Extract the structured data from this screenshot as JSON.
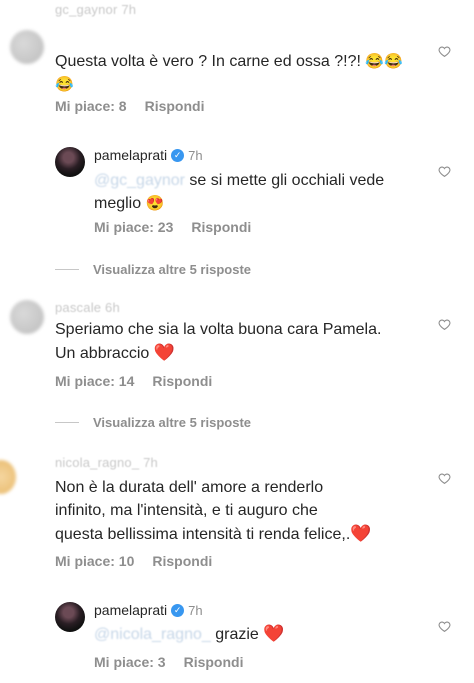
{
  "comments": [
    {
      "author": "gc_gaynor 7h",
      "text": "Questa volta è vero ? In carne ed ossa ?!?!",
      "emoji": "😂😂😂",
      "likes": "Mi piace: 8",
      "reply": "Rispondi"
    },
    {
      "author": "pamelaprati",
      "time": "7h",
      "mention": "@gc_gaynor",
      "text": "se si mette gli occhiali vede meglio",
      "emoji": "😍",
      "likes": "Mi piace: 23",
      "reply": "Rispondi"
    },
    {
      "author": "pascale 6h",
      "text_line1": "Speriamo che sia la volta buona cara Pamela.",
      "text_line2": "Un abbraccio",
      "emoji": "❤️",
      "likes": "Mi piace: 14",
      "reply": "Rispondi"
    },
    {
      "author": "nicola_ragno_ 7h",
      "text_line1": "Non è la durata dell' amore a renderlo",
      "text_line2": "infinito, ma l'intensità, e ti auguro che",
      "text_line3": "questa bellissima intensità ti renda felice,.",
      "emoji": "❤️",
      "likes": "Mi piace: 10",
      "reply": "Rispondi"
    },
    {
      "author": "pamelaprati",
      "time": "7h",
      "mention": "@nicola_ragno_",
      "text": "grazie",
      "emoji": "❤️",
      "likes": "Mi piace: 3",
      "reply": "Rispondi"
    }
  ],
  "view_more_1": "Visualizza altre 5 risposte",
  "view_more_2": "Visualizza altre 5 risposte",
  "verified_glyph": "✓",
  "like_icon": "heart-outline-icon"
}
